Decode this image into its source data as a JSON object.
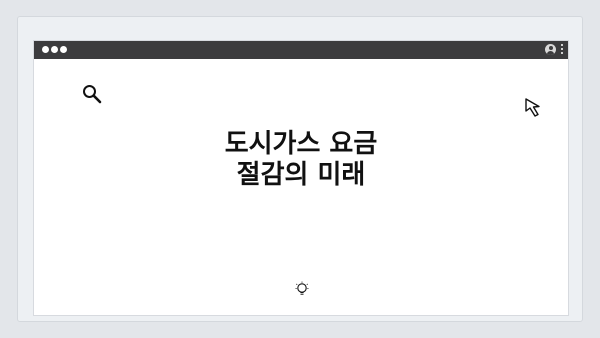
{
  "pager": {
    "count": 4,
    "active": 0
  },
  "window": {
    "titlebar_color": "#3c3c3e",
    "traffic_lights": [
      "dot",
      "dot",
      "dot"
    ],
    "icons": [
      "user-icon",
      "kebab-menu-icon"
    ]
  },
  "headline": {
    "line1": "도시가스 요금",
    "line2": "절감의 미래"
  },
  "decorations": [
    "search-icon",
    "cursor-icon",
    "lightbulb-icon"
  ]
}
